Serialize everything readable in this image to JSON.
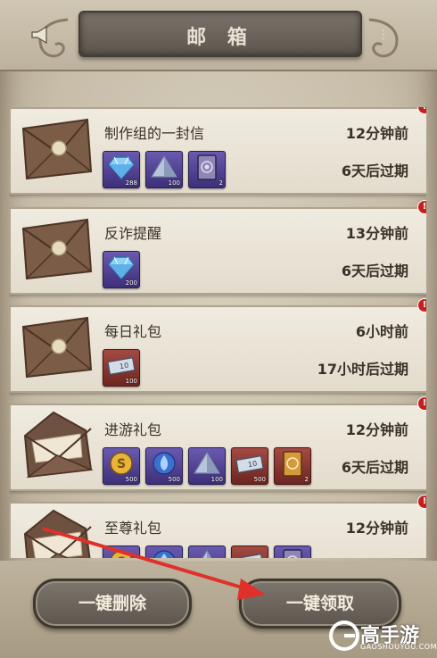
{
  "header": {
    "title": "邮 箱",
    "left_icon": "horn-icon",
    "right_icon": "dots-icon"
  },
  "mails": [
    {
      "title": "制作组的一封信",
      "time": "12分钟前",
      "expire": "6天后过期",
      "envelope": "closed",
      "items": [
        {
          "icon": "diamond-icon",
          "qty": "288",
          "color": "purple"
        },
        {
          "icon": "crystal-icon",
          "qty": "100",
          "color": "purple"
        },
        {
          "icon": "card-icon",
          "qty": "2",
          "color": "purple"
        }
      ]
    },
    {
      "title": "反诈提醒",
      "time": "13分钟前",
      "expire": "6天后过期",
      "envelope": "closed",
      "items": [
        {
          "icon": "diamond-icon",
          "qty": "200",
          "color": "purple"
        }
      ]
    },
    {
      "title": "每日礼包",
      "time": "6小时前",
      "expire": "17小时后过期",
      "envelope": "closed",
      "items": [
        {
          "icon": "ticket-icon",
          "qty": "100",
          "color": "red"
        }
      ]
    },
    {
      "title": "进游礼包",
      "time": "12分钟前",
      "expire": "6天后过期",
      "envelope": "open",
      "items": [
        {
          "icon": "coin-icon",
          "qty": "500",
          "color": "purple"
        },
        {
          "icon": "flame-orb-icon",
          "qty": "500",
          "color": "purple"
        },
        {
          "icon": "crystal-icon",
          "qty": "100",
          "color": "purple"
        },
        {
          "icon": "ticket-icon",
          "qty": "500",
          "color": "red"
        },
        {
          "icon": "gold-card-icon",
          "qty": "2",
          "color": "red"
        }
      ]
    },
    {
      "title": "至尊礼包",
      "time": "12分钟前",
      "expire": "",
      "envelope": "open",
      "items": [
        {
          "icon": "coin-icon",
          "qty": "",
          "color": "purple"
        },
        {
          "icon": "flame-orb-icon",
          "qty": "",
          "color": "purple"
        },
        {
          "icon": "crystal-icon",
          "qty": "",
          "color": "purple"
        },
        {
          "icon": "ticket-icon",
          "qty": "",
          "color": "red"
        },
        {
          "icon": "card-icon",
          "qty": "",
          "color": "purple"
        }
      ]
    }
  ],
  "unread_badge": "!",
  "buttons": {
    "delete_all": "一键删除",
    "claim_all": "一键领取"
  },
  "watermark": {
    "brand": "高手游",
    "url": "GAOSHOUYOU.COM"
  },
  "colors": {
    "badge": "#c91e1e",
    "arrow": "#e0302a"
  }
}
